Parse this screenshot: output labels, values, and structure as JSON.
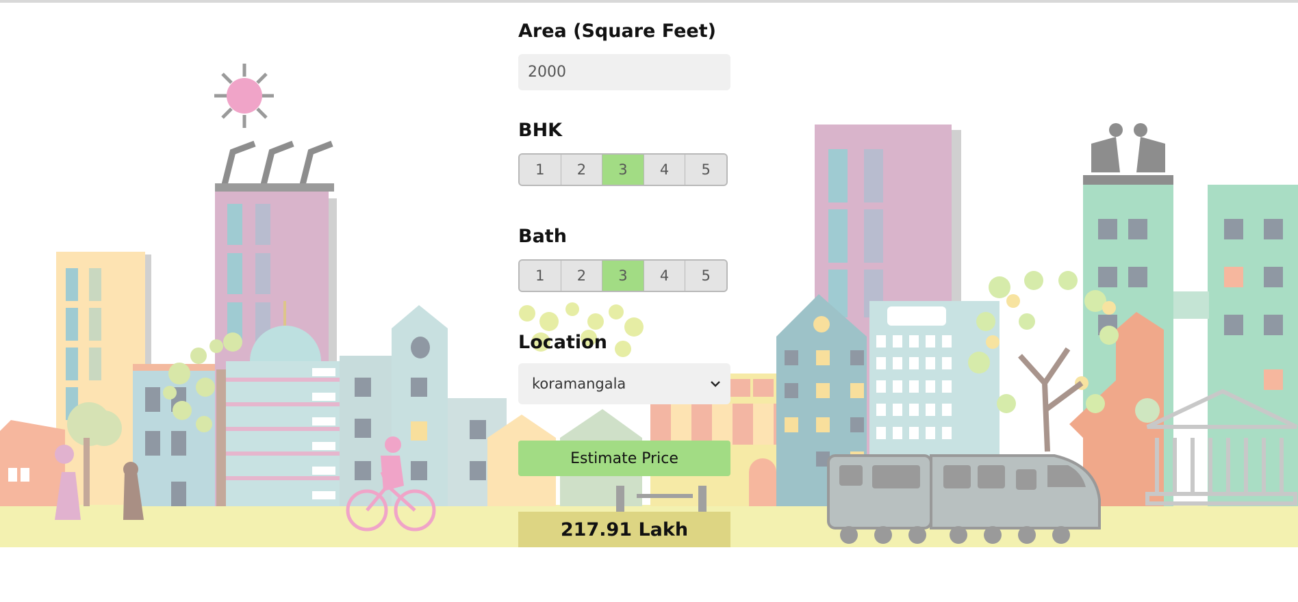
{
  "form": {
    "area_label": "Area (Square Feet)",
    "area_value": "2000",
    "bhk_label": "BHK",
    "bhk_options": [
      "1",
      "2",
      "3",
      "4",
      "5"
    ],
    "bhk_selected": "3",
    "bath_label": "Bath",
    "bath_options": [
      "1",
      "2",
      "3",
      "4",
      "5"
    ],
    "bath_selected": "3",
    "location_label": "Location",
    "location_selected": "koramangala",
    "estimate_button": "Estimate Price",
    "result": "217.91 Lakh"
  },
  "colors": {
    "accent_green": "#a2dc84",
    "result_bg": "#ddd583",
    "ground": "#f3f1b0"
  },
  "icons": {
    "dropdown": "chevron-down-icon"
  }
}
